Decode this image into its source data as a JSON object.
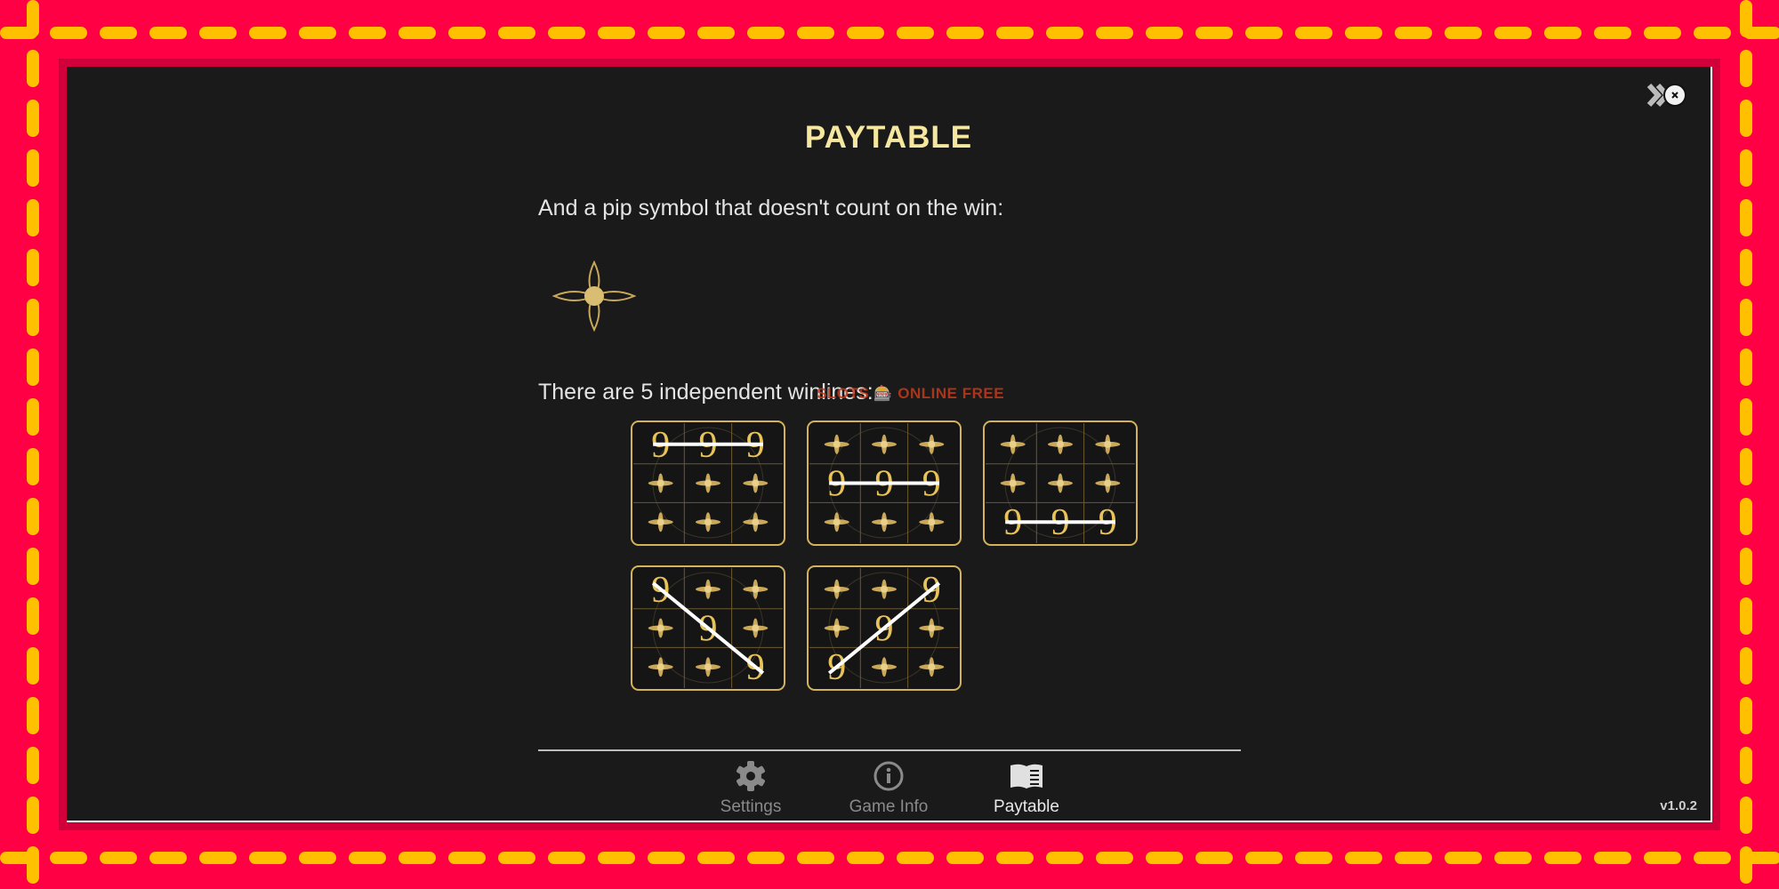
{
  "title": "PAYTABLE",
  "pip_text": "And a pip symbol that doesn't count on the win:",
  "winlines_text": "There are 5 independent winlines:",
  "watermark": "SLOTS 🎰 ONLINE FREE",
  "symbol": "9",
  "winlines": [
    [
      0,
      0,
      0
    ],
    [
      1,
      1,
      1
    ],
    [
      2,
      2,
      2
    ],
    [
      0,
      1,
      2
    ],
    [
      2,
      1,
      0
    ]
  ],
  "tabs": [
    {
      "label": "Settings",
      "icon": "gear-icon",
      "active": false
    },
    {
      "label": "Game Info",
      "icon": "info-icon",
      "active": false
    },
    {
      "label": "Paytable",
      "icon": "book-icon",
      "active": true
    }
  ],
  "version": "v1.0.2",
  "colors": {
    "frame": "#ff0044",
    "dash": "#ffc000",
    "panel": "#1a1a1a",
    "gold": "#d4b25a",
    "title": "#f5e6a0"
  }
}
